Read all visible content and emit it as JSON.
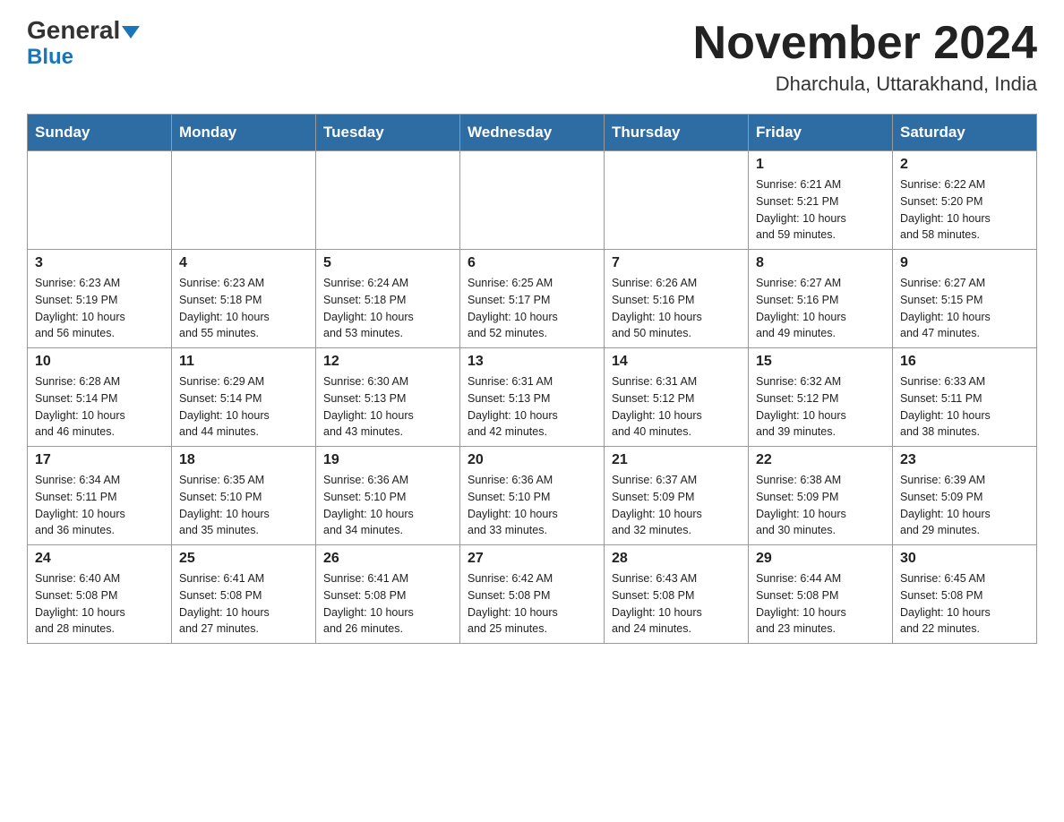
{
  "header": {
    "logo_general": "General",
    "logo_blue": "Blue",
    "month_title": "November 2024",
    "location": "Dharchula, Uttarakhand, India"
  },
  "weekdays": [
    "Sunday",
    "Monday",
    "Tuesday",
    "Wednesday",
    "Thursday",
    "Friday",
    "Saturday"
  ],
  "weeks": [
    [
      {
        "day": "",
        "info": ""
      },
      {
        "day": "",
        "info": ""
      },
      {
        "day": "",
        "info": ""
      },
      {
        "day": "",
        "info": ""
      },
      {
        "day": "",
        "info": ""
      },
      {
        "day": "1",
        "info": "Sunrise: 6:21 AM\nSunset: 5:21 PM\nDaylight: 10 hours\nand 59 minutes."
      },
      {
        "day": "2",
        "info": "Sunrise: 6:22 AM\nSunset: 5:20 PM\nDaylight: 10 hours\nand 58 minutes."
      }
    ],
    [
      {
        "day": "3",
        "info": "Sunrise: 6:23 AM\nSunset: 5:19 PM\nDaylight: 10 hours\nand 56 minutes."
      },
      {
        "day": "4",
        "info": "Sunrise: 6:23 AM\nSunset: 5:18 PM\nDaylight: 10 hours\nand 55 minutes."
      },
      {
        "day": "5",
        "info": "Sunrise: 6:24 AM\nSunset: 5:18 PM\nDaylight: 10 hours\nand 53 minutes."
      },
      {
        "day": "6",
        "info": "Sunrise: 6:25 AM\nSunset: 5:17 PM\nDaylight: 10 hours\nand 52 minutes."
      },
      {
        "day": "7",
        "info": "Sunrise: 6:26 AM\nSunset: 5:16 PM\nDaylight: 10 hours\nand 50 minutes."
      },
      {
        "day": "8",
        "info": "Sunrise: 6:27 AM\nSunset: 5:16 PM\nDaylight: 10 hours\nand 49 minutes."
      },
      {
        "day": "9",
        "info": "Sunrise: 6:27 AM\nSunset: 5:15 PM\nDaylight: 10 hours\nand 47 minutes."
      }
    ],
    [
      {
        "day": "10",
        "info": "Sunrise: 6:28 AM\nSunset: 5:14 PM\nDaylight: 10 hours\nand 46 minutes."
      },
      {
        "day": "11",
        "info": "Sunrise: 6:29 AM\nSunset: 5:14 PM\nDaylight: 10 hours\nand 44 minutes."
      },
      {
        "day": "12",
        "info": "Sunrise: 6:30 AM\nSunset: 5:13 PM\nDaylight: 10 hours\nand 43 minutes."
      },
      {
        "day": "13",
        "info": "Sunrise: 6:31 AM\nSunset: 5:13 PM\nDaylight: 10 hours\nand 42 minutes."
      },
      {
        "day": "14",
        "info": "Sunrise: 6:31 AM\nSunset: 5:12 PM\nDaylight: 10 hours\nand 40 minutes."
      },
      {
        "day": "15",
        "info": "Sunrise: 6:32 AM\nSunset: 5:12 PM\nDaylight: 10 hours\nand 39 minutes."
      },
      {
        "day": "16",
        "info": "Sunrise: 6:33 AM\nSunset: 5:11 PM\nDaylight: 10 hours\nand 38 minutes."
      }
    ],
    [
      {
        "day": "17",
        "info": "Sunrise: 6:34 AM\nSunset: 5:11 PM\nDaylight: 10 hours\nand 36 minutes."
      },
      {
        "day": "18",
        "info": "Sunrise: 6:35 AM\nSunset: 5:10 PM\nDaylight: 10 hours\nand 35 minutes."
      },
      {
        "day": "19",
        "info": "Sunrise: 6:36 AM\nSunset: 5:10 PM\nDaylight: 10 hours\nand 34 minutes."
      },
      {
        "day": "20",
        "info": "Sunrise: 6:36 AM\nSunset: 5:10 PM\nDaylight: 10 hours\nand 33 minutes."
      },
      {
        "day": "21",
        "info": "Sunrise: 6:37 AM\nSunset: 5:09 PM\nDaylight: 10 hours\nand 32 minutes."
      },
      {
        "day": "22",
        "info": "Sunrise: 6:38 AM\nSunset: 5:09 PM\nDaylight: 10 hours\nand 30 minutes."
      },
      {
        "day": "23",
        "info": "Sunrise: 6:39 AM\nSunset: 5:09 PM\nDaylight: 10 hours\nand 29 minutes."
      }
    ],
    [
      {
        "day": "24",
        "info": "Sunrise: 6:40 AM\nSunset: 5:08 PM\nDaylight: 10 hours\nand 28 minutes."
      },
      {
        "day": "25",
        "info": "Sunrise: 6:41 AM\nSunset: 5:08 PM\nDaylight: 10 hours\nand 27 minutes."
      },
      {
        "day": "26",
        "info": "Sunrise: 6:41 AM\nSunset: 5:08 PM\nDaylight: 10 hours\nand 26 minutes."
      },
      {
        "day": "27",
        "info": "Sunrise: 6:42 AM\nSunset: 5:08 PM\nDaylight: 10 hours\nand 25 minutes."
      },
      {
        "day": "28",
        "info": "Sunrise: 6:43 AM\nSunset: 5:08 PM\nDaylight: 10 hours\nand 24 minutes."
      },
      {
        "day": "29",
        "info": "Sunrise: 6:44 AM\nSunset: 5:08 PM\nDaylight: 10 hours\nand 23 minutes."
      },
      {
        "day": "30",
        "info": "Sunrise: 6:45 AM\nSunset: 5:08 PM\nDaylight: 10 hours\nand 22 minutes."
      }
    ]
  ]
}
